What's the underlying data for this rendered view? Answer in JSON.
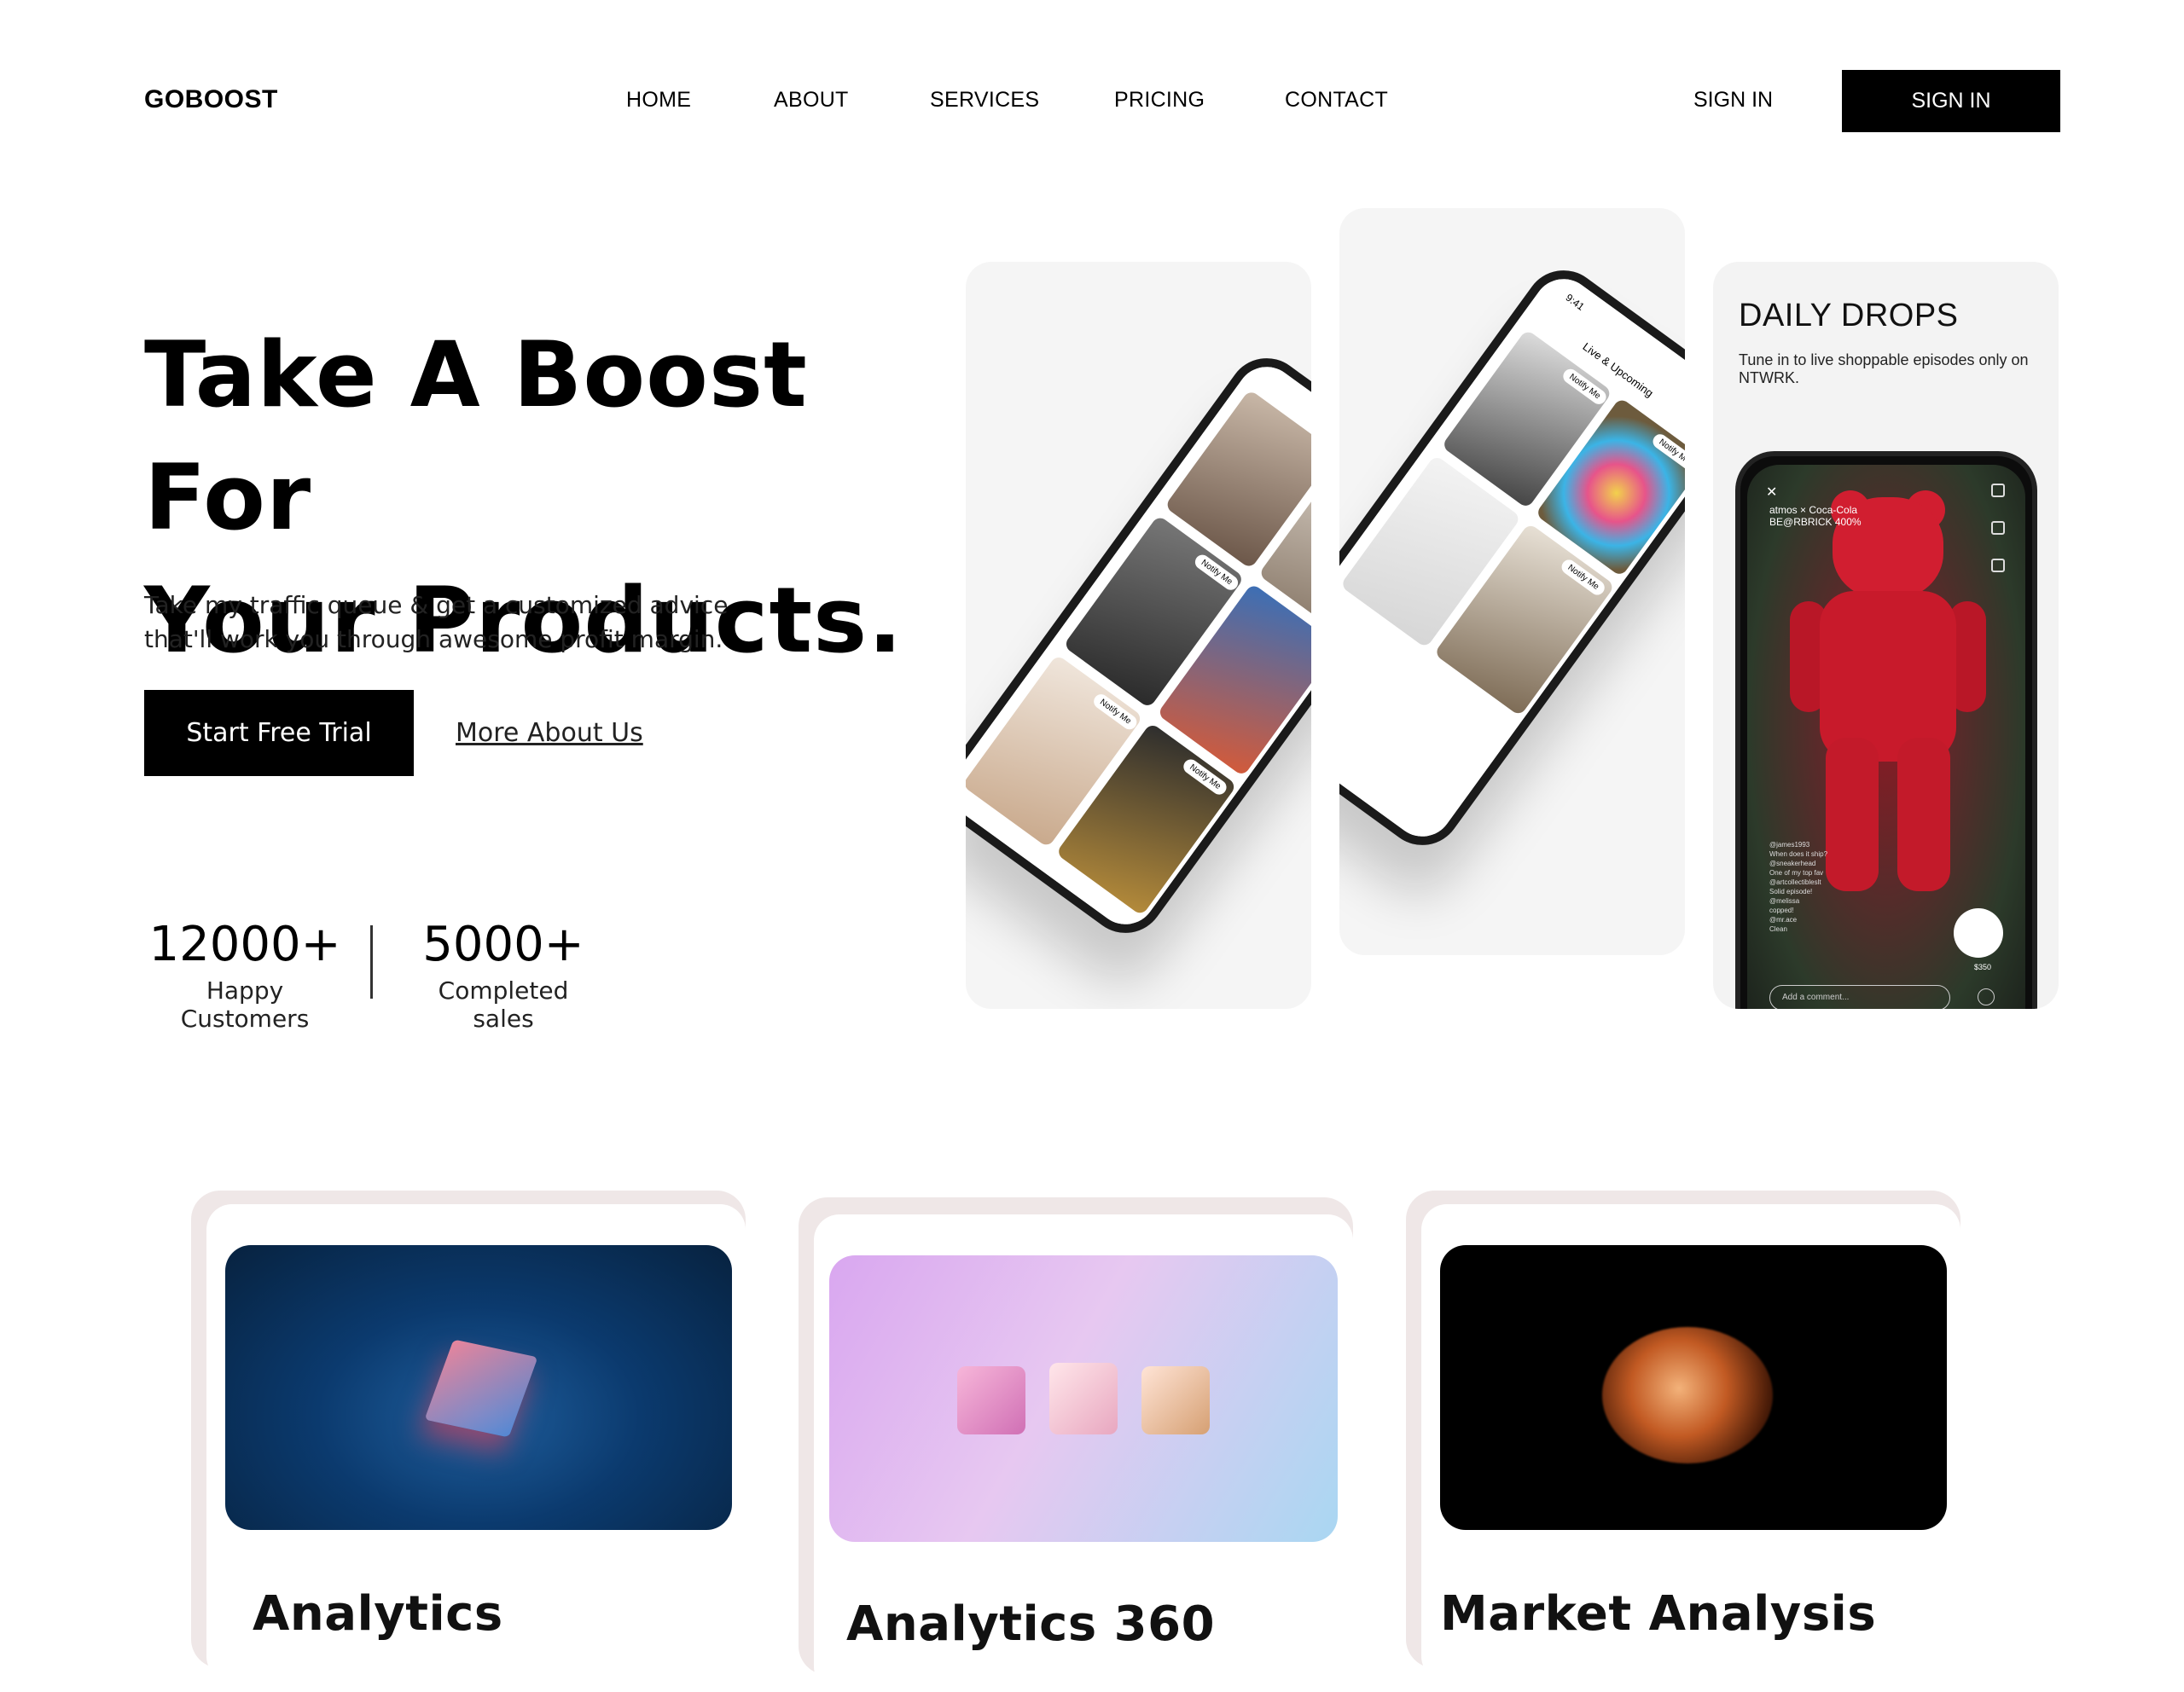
{
  "nav": {
    "brand": "GOBOOST",
    "links": [
      "HOME",
      "ABOUT",
      "SERVICES",
      "PRICING",
      "CONTACT"
    ],
    "signin_link": "SIGN IN",
    "signin_button": "SIGN IN"
  },
  "hero": {
    "title_line1": "Take A Boost For",
    "title_line2": "Your Products.",
    "subtitle_line1": "Take my traffic queue & get a customized advice",
    "subtitle_line2": "that'll work you through awesome profit margin.",
    "cta_label": "Start Free Trial",
    "more_label": "More About Us",
    "stats": [
      {
        "number": "12000+",
        "label": "Happy Customers"
      },
      {
        "number": "5000+",
        "label": "Completed sales"
      }
    ]
  },
  "showcase": {
    "phone2_header": "Live & Upcoming",
    "phone2_time": "9:41",
    "notify_label": "Notify Me",
    "daily_title": "DAILY DROPS",
    "daily_subtitle": "Tune in to live shoppable episodes only on NTWRK.",
    "stream_caption_line1": "atmos × Coca-Cola",
    "stream_caption_line2": "BE@RBRICK 400%",
    "comments": [
      "@james1993",
      "When does it ship?",
      "@sneakerhead",
      "One of my top fav",
      "@artcollectibleslt",
      "Solid episode!",
      "@melissa",
      "copped!",
      "@mr.ace",
      "Clean"
    ],
    "comment_placeholder": "Add a comment...",
    "price": "$350"
  },
  "cards": [
    {
      "title": "Analytics"
    },
    {
      "title": "Analytics 360"
    },
    {
      "title": "Market Analysis"
    }
  ],
  "colors": {
    "primary": "#000000",
    "background": "#ffffff",
    "panel": "#f5f5f5",
    "card_shadow": "#efe7e7"
  }
}
